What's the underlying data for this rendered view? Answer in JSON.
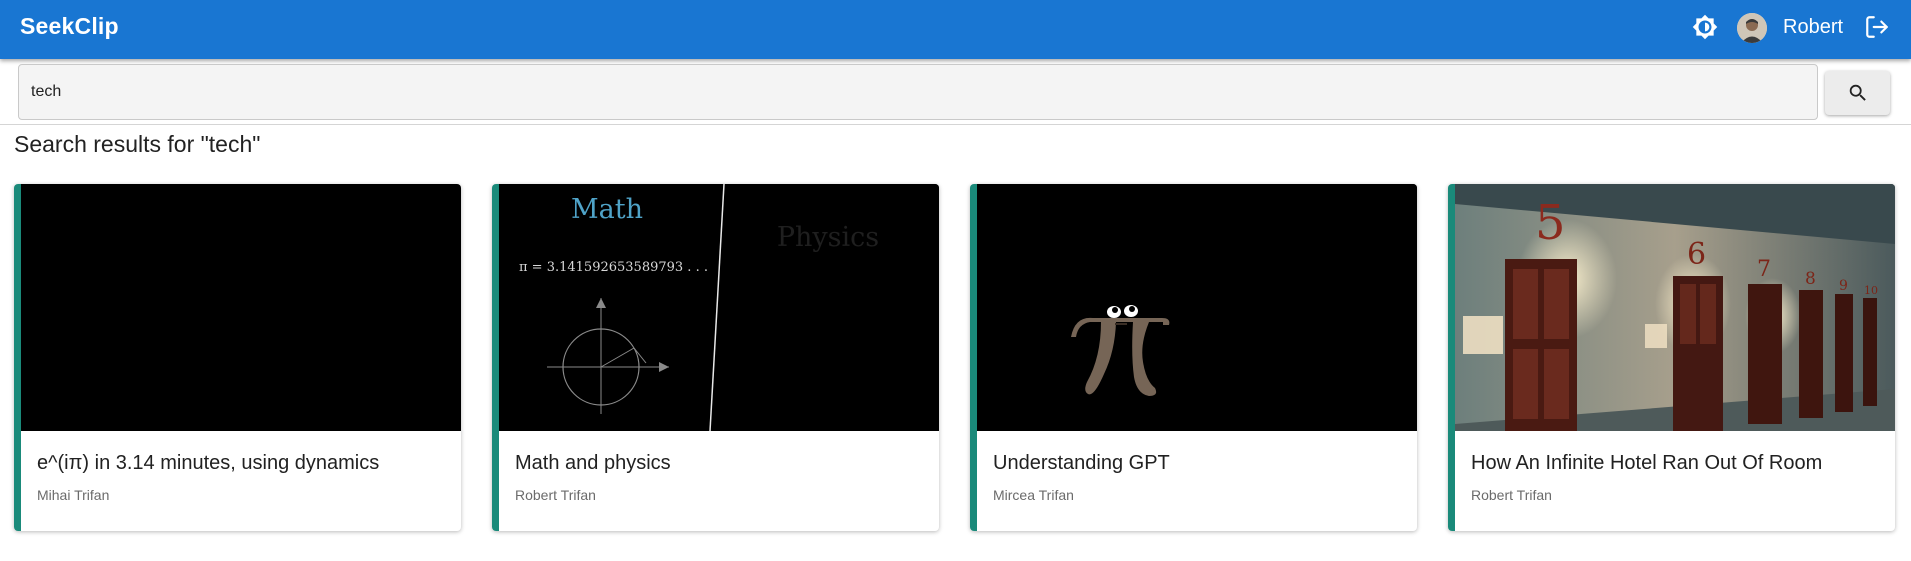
{
  "app": {
    "brand": "SeekClip"
  },
  "header": {
    "username": "Robert",
    "theme_icon": "brightness-icon",
    "logout_icon": "logout-icon"
  },
  "search": {
    "value": "tech",
    "button_icon": "search-icon"
  },
  "results": {
    "title": "Search results for \"tech\"",
    "cards": [
      {
        "title": "e^(iπ) in 3.14 minutes, using dynamics",
        "author": "Mihai Trifan"
      },
      {
        "title": "Math and physics",
        "author": "Robert Trifan",
        "thumb_math": "Math",
        "thumb_physics": "Physics",
        "thumb_pi": "π = 3.141592653589793 . . ."
      },
      {
        "title": "Understanding GPT",
        "author": "Mircea Trifan"
      },
      {
        "title": "How An Infinite Hotel Ran Out Of Room",
        "author": "Robert Trifan"
      }
    ]
  },
  "colors": {
    "appbar": "#1976d2",
    "accent": "#1a8a7a"
  }
}
